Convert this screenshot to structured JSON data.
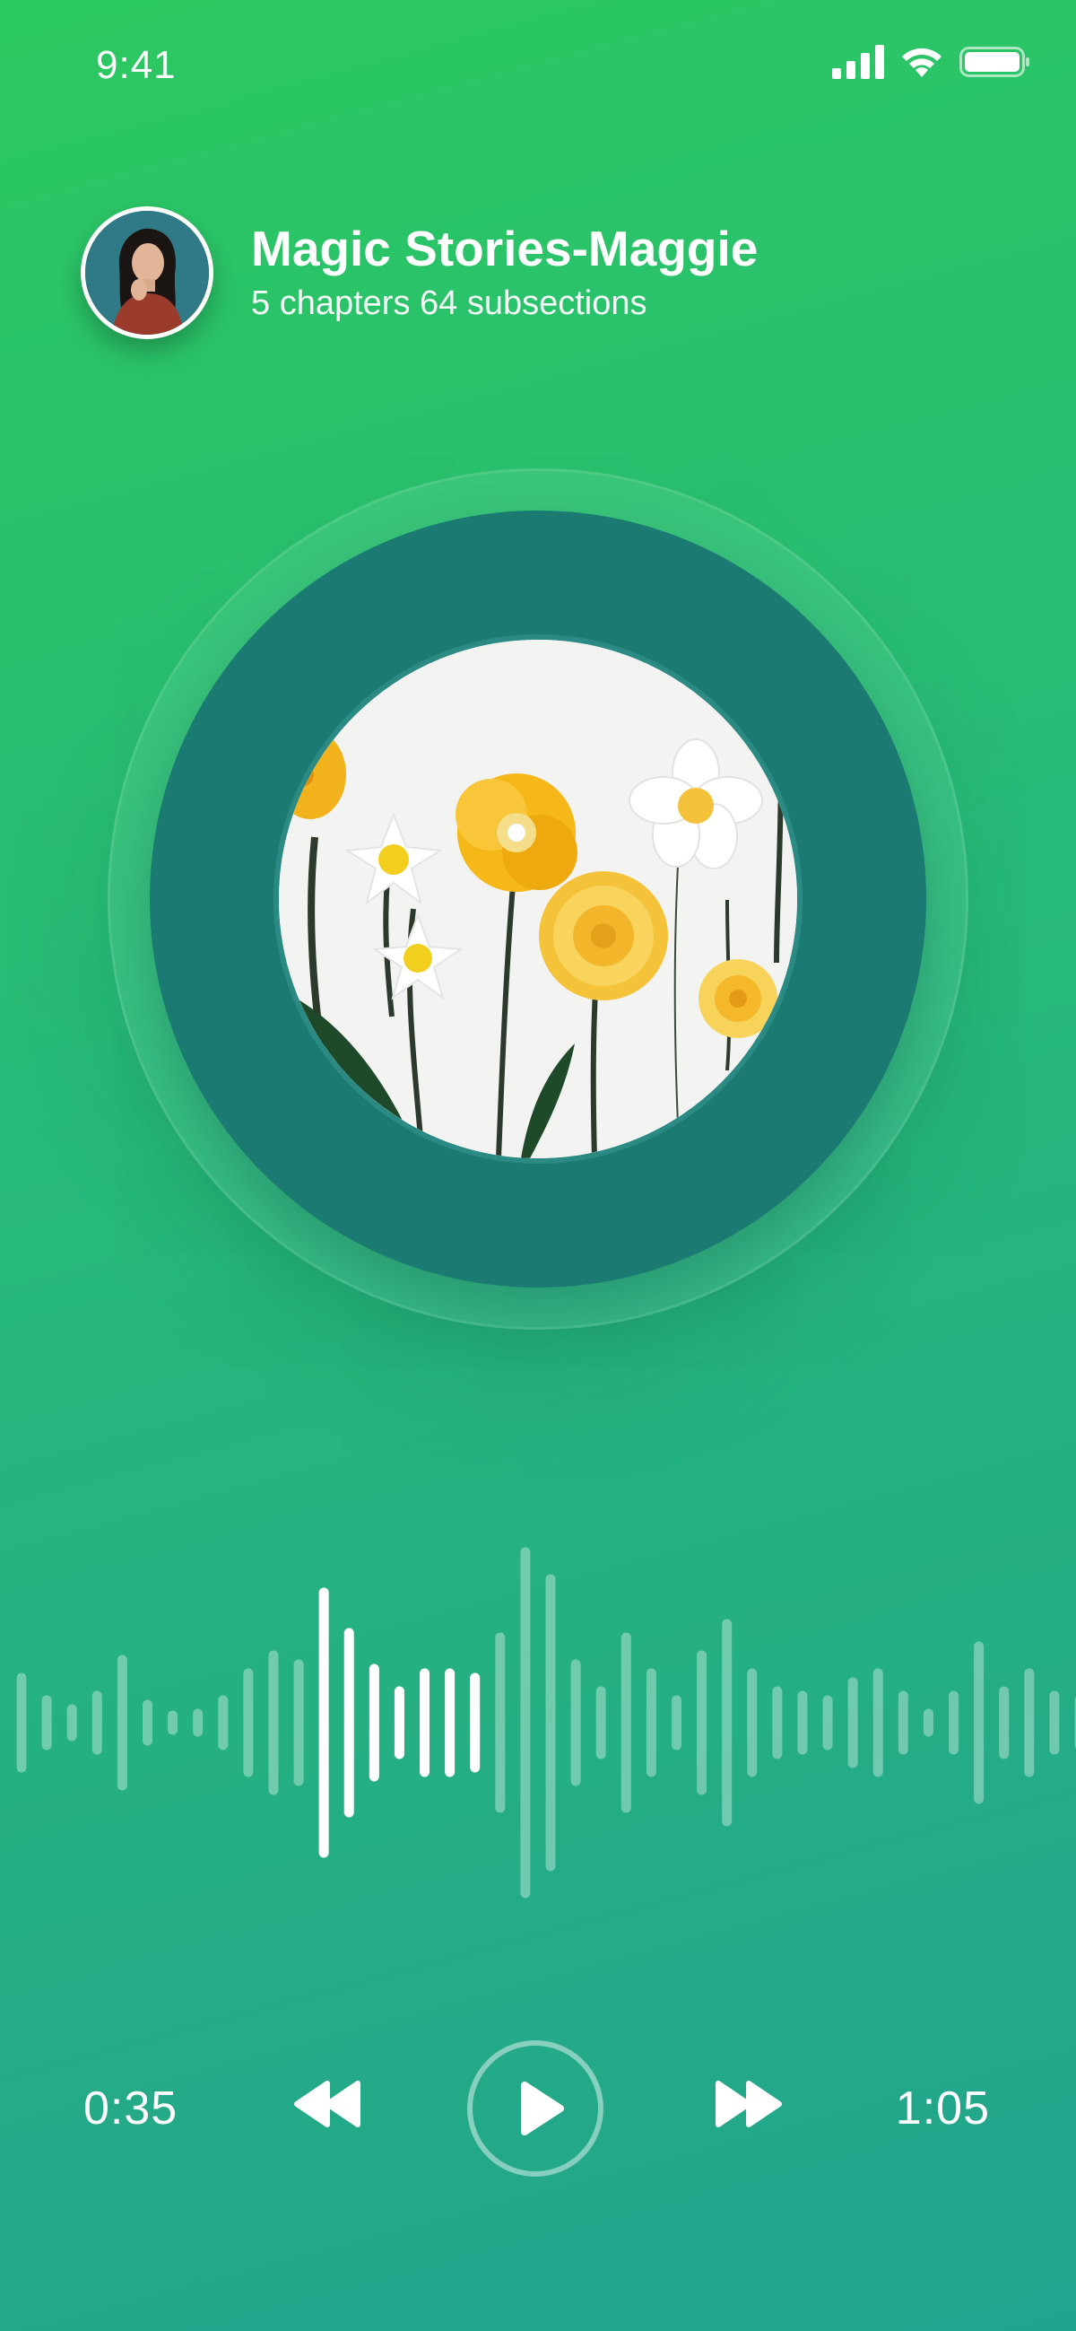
{
  "status_bar": {
    "time": "9:41",
    "icons": [
      "cellular-signal-icon",
      "wifi-icon",
      "battery-icon"
    ]
  },
  "header": {
    "title": "Magic Stories-Maggie",
    "subtitle": "5 chapters 64 subsections",
    "avatar_icon": "narrator-avatar"
  },
  "album": {
    "artwork": "paper-flowers-artwork",
    "colors": {
      "ring": "#1b7a71",
      "background_top": "#2cc860",
      "background_bottom": "#22a38e"
    }
  },
  "player": {
    "elapsed": "0:35",
    "total": "1:05",
    "progress_fraction": 0.54,
    "icons": {
      "rewind": "rewind-icon",
      "play": "play-icon",
      "forward": "fast-forward-icon"
    }
  }
}
